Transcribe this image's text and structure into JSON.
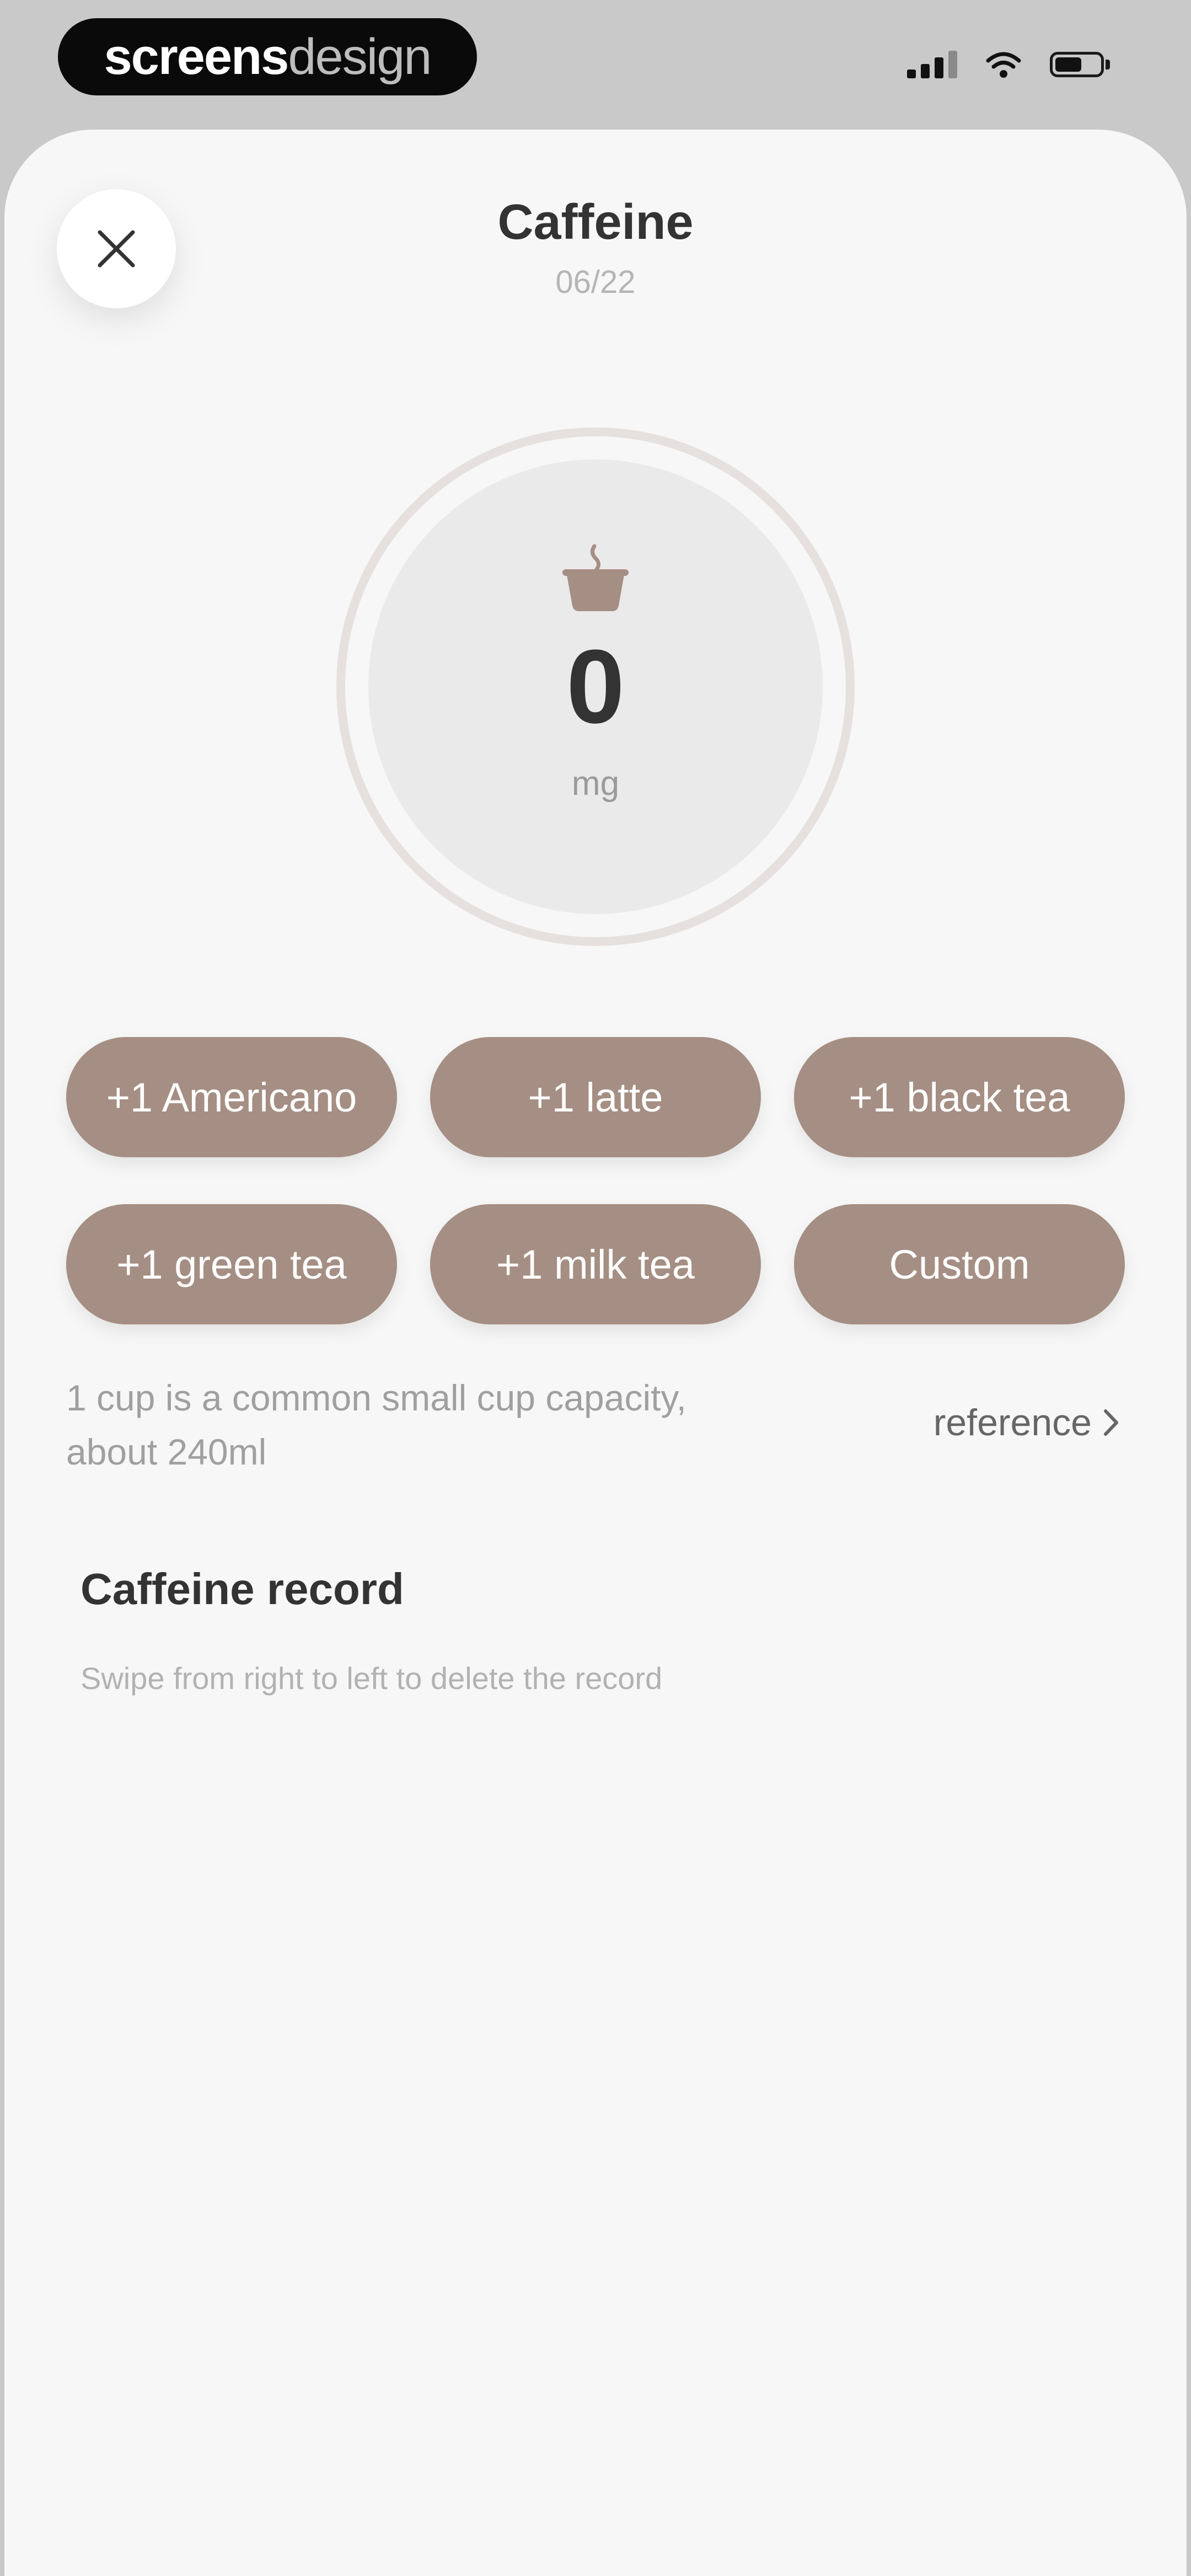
{
  "status_bar": {
    "brand_strong": "screens",
    "brand_light": "design",
    "icons": [
      "signal-icon",
      "wifi-icon",
      "battery-icon"
    ]
  },
  "header": {
    "title": "Caffeine",
    "date": "06/22",
    "close_icon": "close-icon"
  },
  "gauge": {
    "icon": "coffee-cup-icon",
    "value": "0",
    "unit": "mg",
    "accent_color": "#a58e83",
    "ring_color": "#e6e1de"
  },
  "drinks": [
    {
      "label": "+1 Americano"
    },
    {
      "label": "+1 latte"
    },
    {
      "label": "+1 black tea"
    },
    {
      "label": "+1 green tea"
    },
    {
      "label": "+1 milk tea"
    },
    {
      "label": "Custom"
    }
  ],
  "note": {
    "text": "1 cup is a common small cup capacity, about 240ml",
    "reference_label": "reference"
  },
  "record": {
    "title": "Caffeine record",
    "hint": "Swipe from right to left to delete the record"
  }
}
